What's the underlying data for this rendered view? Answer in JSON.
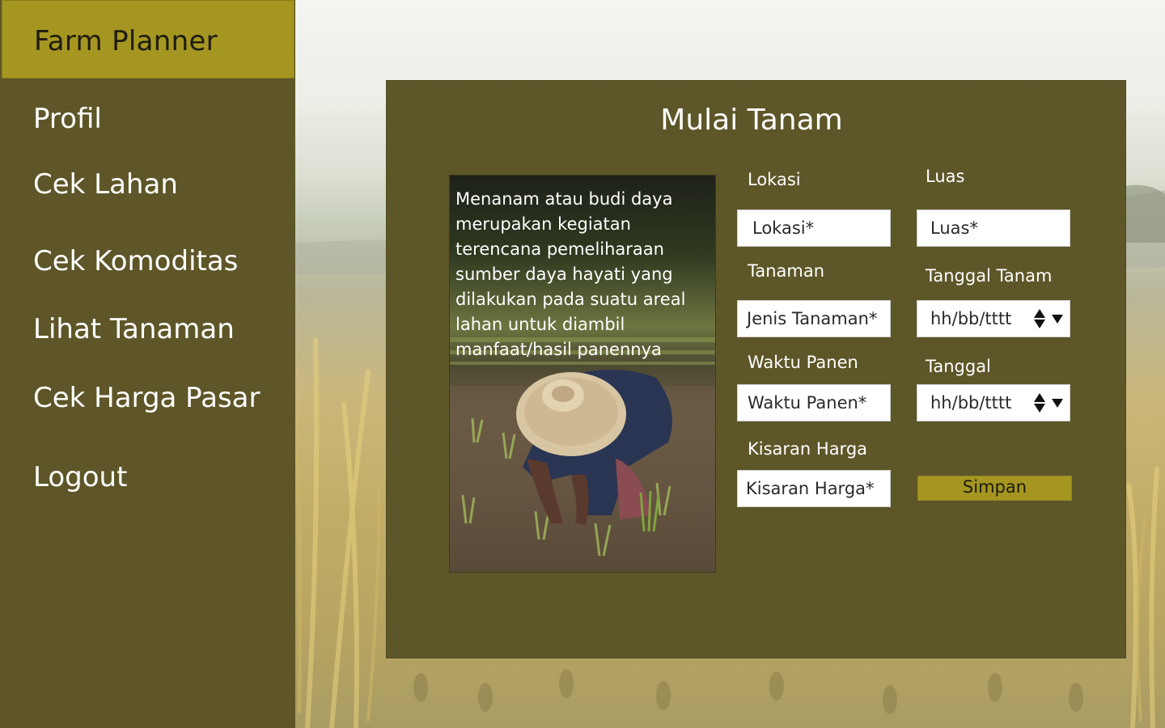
{
  "app": {
    "title": "Farm Planner"
  },
  "sidebar": {
    "items": [
      {
        "label": "Profil"
      },
      {
        "label": "Cek Lahan"
      },
      {
        "label": "Cek Komoditas"
      },
      {
        "label": "Lihat Tanaman"
      },
      {
        "label": "Cek Harga Pasar"
      },
      {
        "label": "Logout"
      }
    ]
  },
  "form": {
    "title": "Mulai Tanam",
    "description": "Menanam atau budi daya merupakan kegiatan terencana pemeliharaan sumber daya hayati yang dilakukan pada suatu areal lahan untuk diambil manfaat/hasil panennya",
    "fields": {
      "lokasi": {
        "label": "Lokasi",
        "placeholder": "Lokasi*"
      },
      "luas": {
        "label": "Luas",
        "placeholder": "Luas*"
      },
      "tanaman": {
        "label": "Tanaman",
        "placeholder": "Jenis Tanaman*"
      },
      "tanggal_tanam": {
        "label": "Tanggal Tanam",
        "placeholder": "hh/bb/tttt"
      },
      "waktu_panen": {
        "label": "Waktu Panen",
        "placeholder": "Waktu Panen*"
      },
      "tanggal": {
        "label": "Tanggal",
        "placeholder": "hh/bb/tttt"
      },
      "kisaran_harga": {
        "label": "Kisaran Harga",
        "placeholder": "Kisaran Harga*"
      }
    },
    "save_label": "Simpan"
  },
  "colors": {
    "sidebar_bg": "#5e5628",
    "brand_bg": "#a59621",
    "panel_bg": "#5d5628",
    "button_bg": "#a59621"
  }
}
